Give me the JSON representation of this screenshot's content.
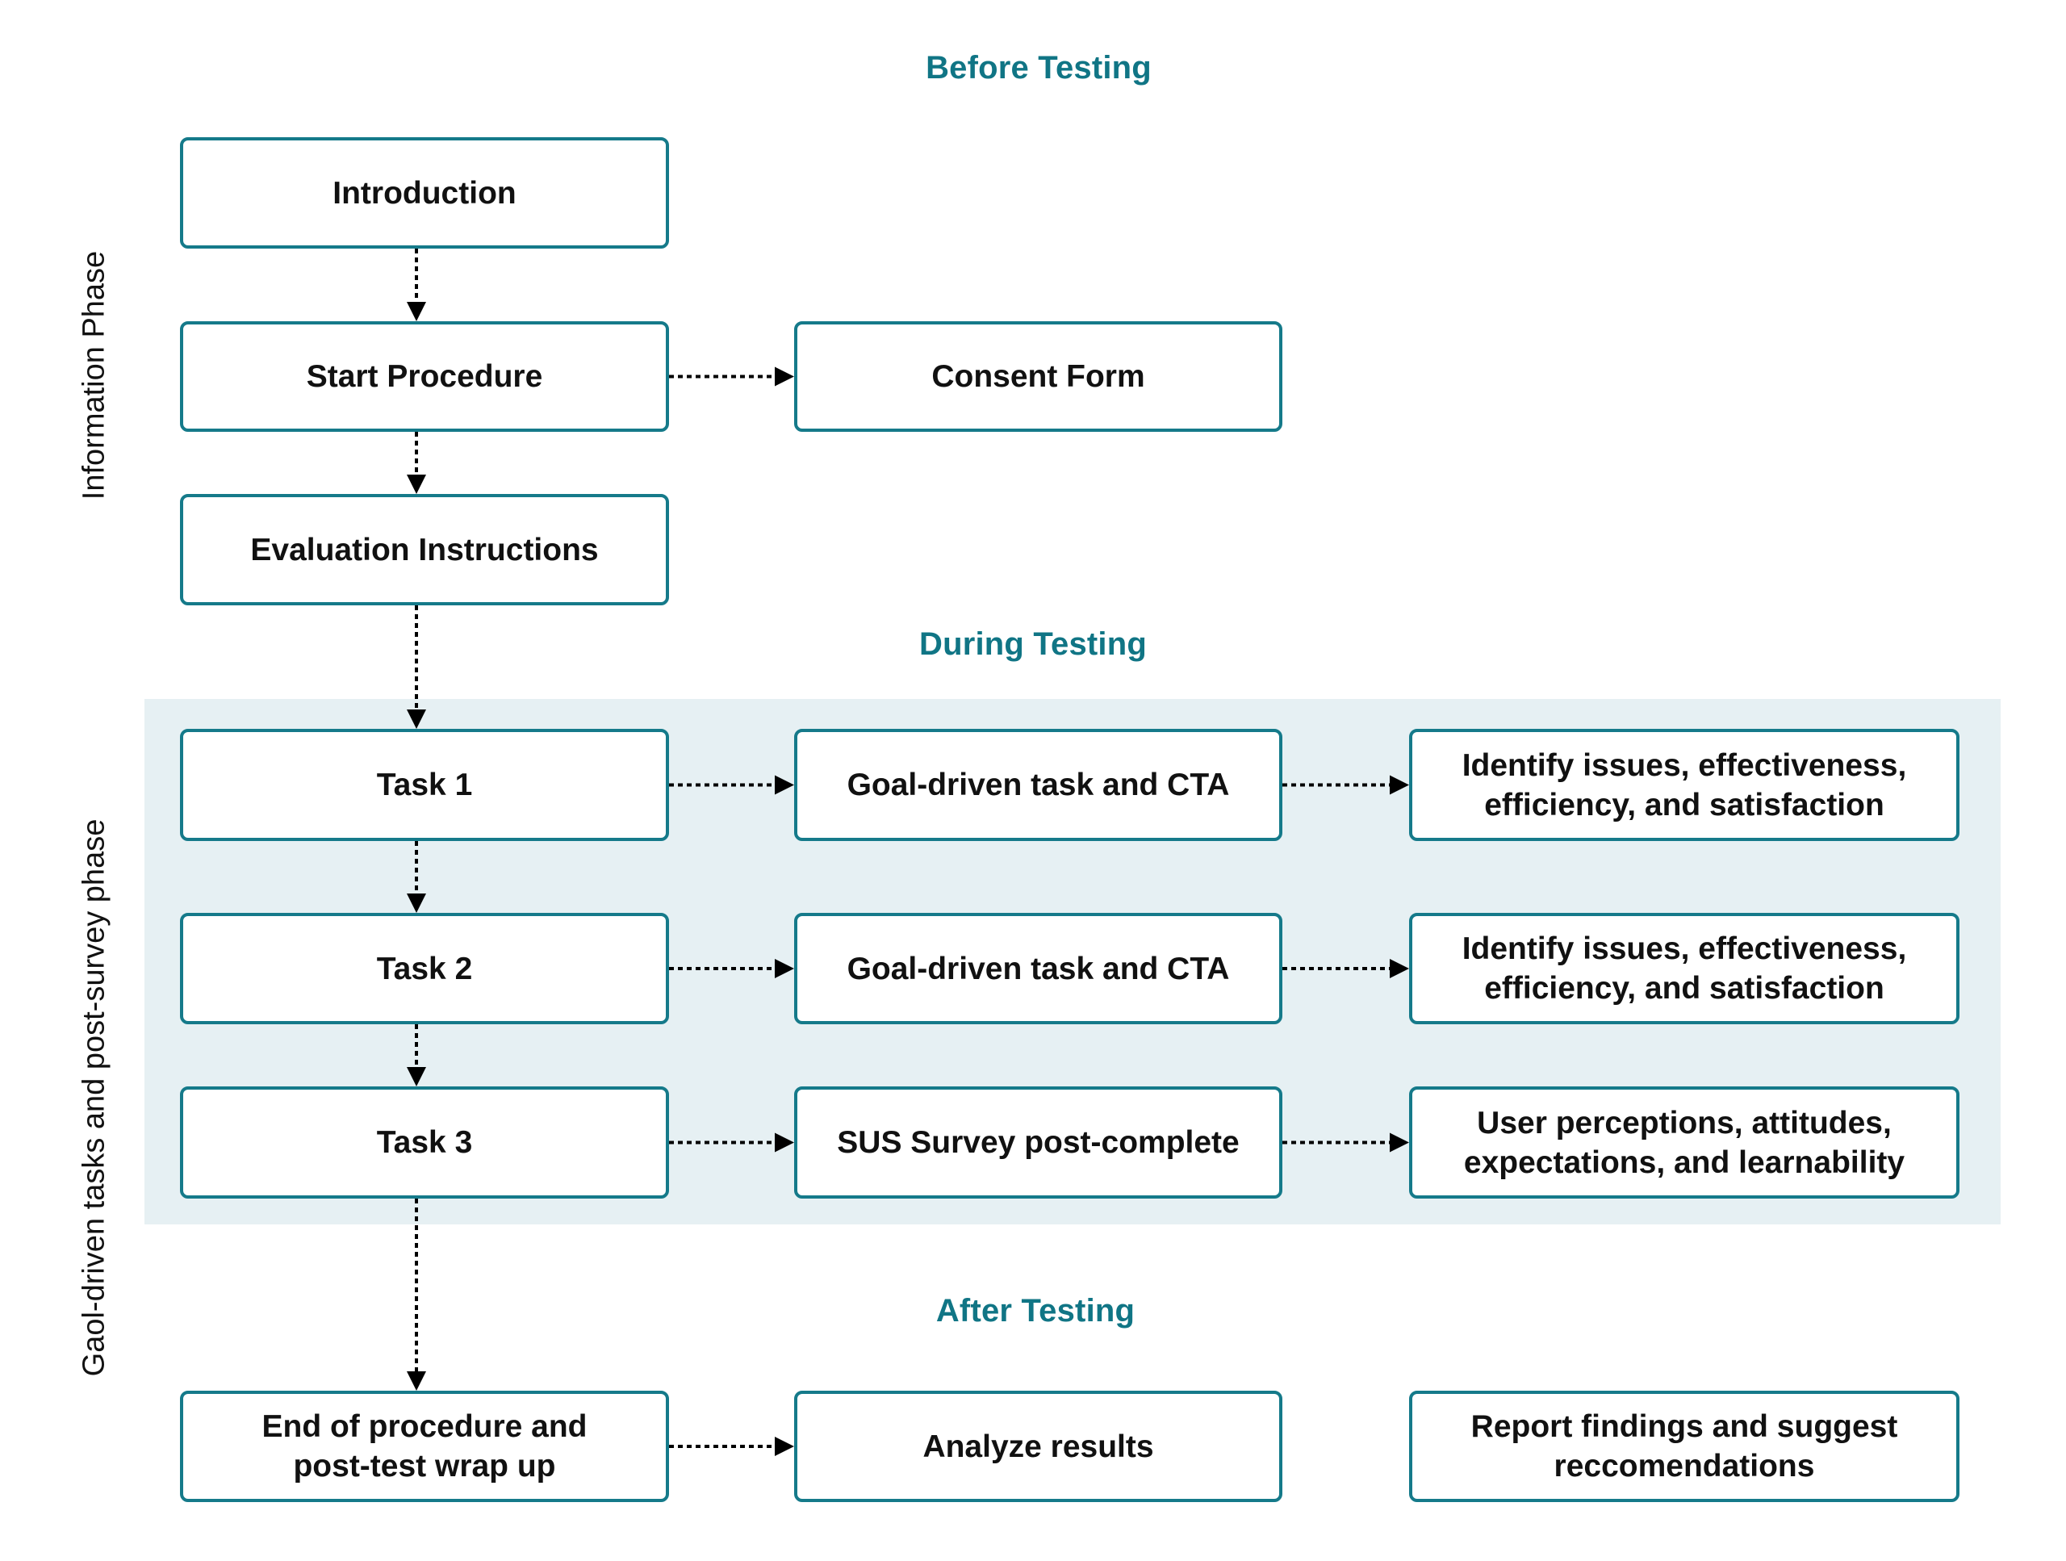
{
  "colors": {
    "accent": "#107585",
    "box_border": "#157a8a",
    "panel_background": "#e6f0f3",
    "arrow": "#000000"
  },
  "sections": {
    "before": "Before Testing",
    "during": "During Testing",
    "after": "After Testing"
  },
  "side_labels": {
    "information_phase": "Information Phase",
    "task_phase": "Gaol-driven tasks and post-survey phase"
  },
  "nodes": {
    "introduction": "Introduction",
    "start_procedure": "Start Procedure",
    "consent_form": "Consent Form",
    "evaluation_instructions": "Evaluation Instructions",
    "task1": "Task 1",
    "task1_goal": "Goal-driven task and CTA",
    "task1_outcome": "Identify issues, effectiveness,\nefficiency, and satisfaction",
    "task2": "Task 2",
    "task2_goal": "Goal-driven task and CTA",
    "task2_outcome": "Identify issues, effectiveness,\nefficiency, and satisfaction",
    "task3": "Task 3",
    "task3_survey": "SUS Survey post-complete",
    "task3_outcome": "User perceptions, attitudes,\nexpectations, and learnability",
    "end_procedure": "End of procedure and\npost-test wrap up",
    "analyze_results": "Analyze results",
    "report_findings": "Report findings and suggest\nreccomendations"
  },
  "edges": [
    {
      "from": "introduction",
      "to": "start_procedure",
      "style": "dotted"
    },
    {
      "from": "start_procedure",
      "to": "consent_form",
      "style": "dotted"
    },
    {
      "from": "start_procedure",
      "to": "evaluation_instructions",
      "style": "dotted"
    },
    {
      "from": "evaluation_instructions",
      "to": "task1",
      "style": "dotted"
    },
    {
      "from": "task1",
      "to": "task1_goal",
      "style": "dotted"
    },
    {
      "from": "task1_goal",
      "to": "task1_outcome",
      "style": "dotted"
    },
    {
      "from": "task1",
      "to": "task2",
      "style": "dotted"
    },
    {
      "from": "task2",
      "to": "task2_goal",
      "style": "dotted"
    },
    {
      "from": "task2_goal",
      "to": "task2_outcome",
      "style": "dotted"
    },
    {
      "from": "task2",
      "to": "task3",
      "style": "dotted"
    },
    {
      "from": "task3",
      "to": "task3_survey",
      "style": "dotted"
    },
    {
      "from": "task3_survey",
      "to": "task3_outcome",
      "style": "dotted"
    },
    {
      "from": "task3",
      "to": "end_procedure",
      "style": "dotted"
    },
    {
      "from": "end_procedure",
      "to": "analyze_results",
      "style": "dotted"
    }
  ]
}
